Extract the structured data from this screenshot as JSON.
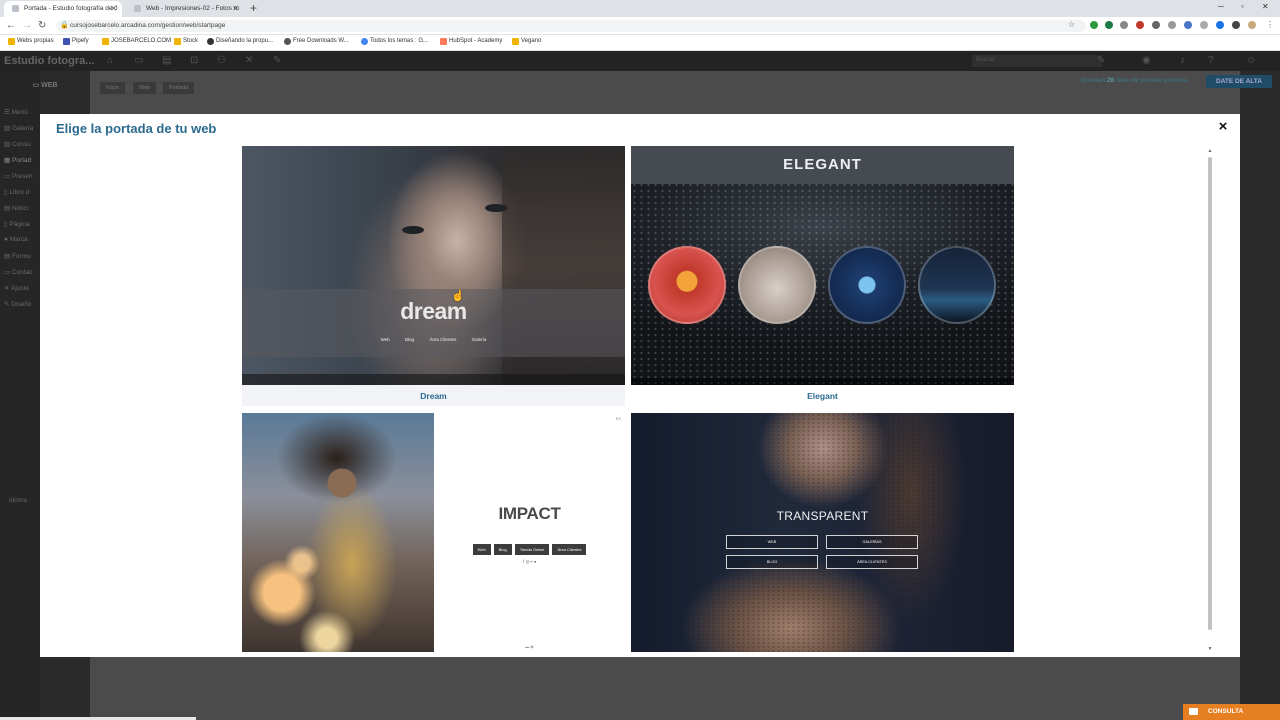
{
  "browser": {
    "tabs": [
      {
        "title": "Portada - Estudio fotografía de J"
      },
      {
        "title": "Web - Impresiones-02 - Fotos m"
      }
    ],
    "url": "cursojosebarcelo.arcadina.com/gestion/web/startpage",
    "bookmarks": [
      "Webs propias",
      "Pipefy",
      "JOSEBARCELO.COM",
      "Stock",
      "Diseñando la propu...",
      "Free Downloads W...",
      "Todos los temas : G...",
      "HubSpot - Academy",
      "Vegano"
    ]
  },
  "app": {
    "brand": "Estudio fotogra...",
    "section": "WEB",
    "sidebar": [
      "Menú",
      "Galería",
      "Consu",
      "Portad",
      "Presen",
      "Libro d",
      "Notici",
      "Página",
      "Marca",
      "Formu",
      "Contac",
      "Ajuste",
      "Diseño"
    ],
    "breadcrumb": [
      "Inicio",
      "Web",
      "Portada"
    ],
    "search_placeholder": "Buscar",
    "trial_prefix": "Quedan",
    "trial_days": "28",
    "trial_suffix": "días de prueba gratuita",
    "signup_button": "DATE DE ALTA",
    "idioma": "Idioma"
  },
  "modal": {
    "title": "Elige la portada de tu web",
    "close_label": "×",
    "templates": [
      {
        "name": "Dream",
        "logo": "dream",
        "menu": [
          "Web",
          "Blog",
          "Área Clientes",
          "Galería"
        ],
        "selected": true
      },
      {
        "name": "Elegant",
        "logo": "ELEGANT",
        "selected": false
      },
      {
        "name": "Impact",
        "logo": "IMPACT",
        "menu": [
          "Web",
          "Blog",
          "Tienda Online",
          "Área Clientes"
        ],
        "lang": "ES",
        "selected": false
      },
      {
        "name": "Transparent",
        "logo": "TRANSPARENT",
        "buttons": [
          "WEB",
          "GALERÍAS",
          "BLOG",
          "ÁREA CLIENTES"
        ],
        "selected": false
      }
    ]
  },
  "chat": {
    "label": "CONSULTA"
  },
  "colors": {
    "accent": "#2b6a8f",
    "signup": "#1f4c66",
    "consulta": "#e67e22"
  }
}
